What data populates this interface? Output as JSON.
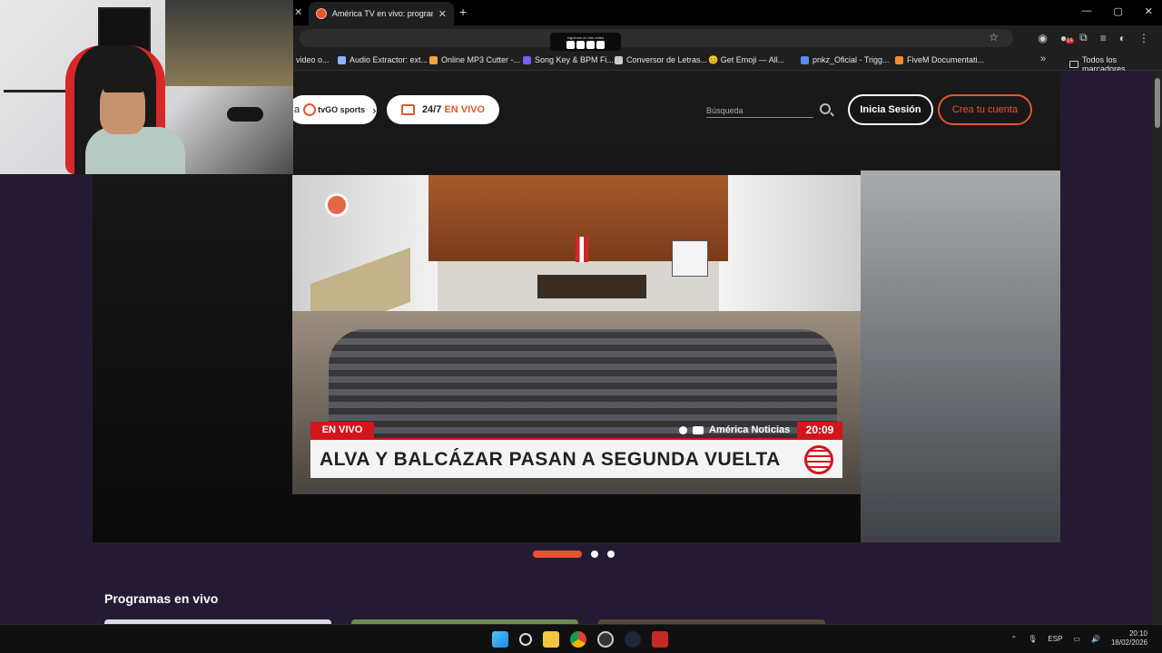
{
  "browser": {
    "active_tab_title": "América TV en vivo: programac",
    "window_controls": [
      "—",
      "▢",
      "✕"
    ],
    "bookmarks": [
      {
        "label": "video o...",
        "icon": "page-icon"
      },
      {
        "label": "Audio Extractor: ext...",
        "icon": "page-icon"
      },
      {
        "label": "Online MP3 Cutter -...",
        "icon": "page-icon"
      },
      {
        "label": "Song Key & BPM Fi...",
        "icon": "page-icon"
      },
      {
        "label": "Conversor de Letras...",
        "icon": "page-icon"
      },
      {
        "label": "😊 Get Emoji — All...",
        "icon": "emoji-icon"
      },
      {
        "label": "pnkz_Oficial - Trigg...",
        "icon": "page-icon"
      },
      {
        "label": "FiveM Documentati...",
        "icon": "page-icon"
      }
    ],
    "bookmarks_more": "»",
    "all_bookmarks_label": "Todos los marcadores",
    "social_badge_text": "síguenos en mis redes",
    "extension_badge_count": "14"
  },
  "site": {
    "tvgo_prefix": "a",
    "tvgo_logo_text": "tvGO sports",
    "live_247_label_prefix": "24/7",
    "live_247_label_highlight": "EN VIVO",
    "search_placeholder": "Búsqueda",
    "login_label": "Inicia Sesión",
    "signup_label": "Crea tu cuenta",
    "accent_color": "#e8542f"
  },
  "video": {
    "live_badge": "EN VIVO",
    "channel": "América Noticias",
    "time": "20:09",
    "headline": "ALVA Y BALCÁZAR PASAN A SEGUNDA VUELTA"
  },
  "carousel": {
    "active_index": 0,
    "total": 3
  },
  "programs": {
    "title": "Programas en vivo"
  },
  "taskbar": {
    "language": "ESP",
    "time": "20:10",
    "date": "18/02/2026"
  }
}
